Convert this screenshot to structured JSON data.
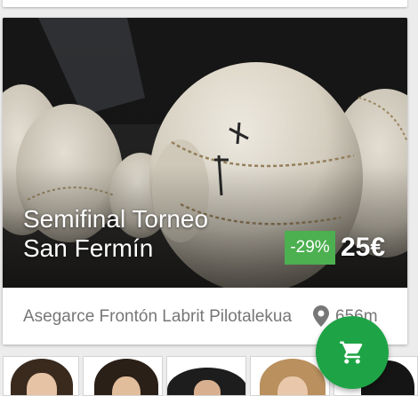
{
  "event": {
    "title": "Semifinal Torneo\nSan Fermín",
    "discount": "-29%",
    "price": "25€",
    "venue": "Asegarce Frontón Labrit Pilotalekua",
    "distance": "656m",
    "image_subject": "pelota balls"
  },
  "icons": {
    "location": "map-pin-icon",
    "cart": "shopping-cart-icon"
  },
  "colors": {
    "discount_green": "#4caf50",
    "fab_green": "#1ea446",
    "secondary_text": "#777777"
  }
}
